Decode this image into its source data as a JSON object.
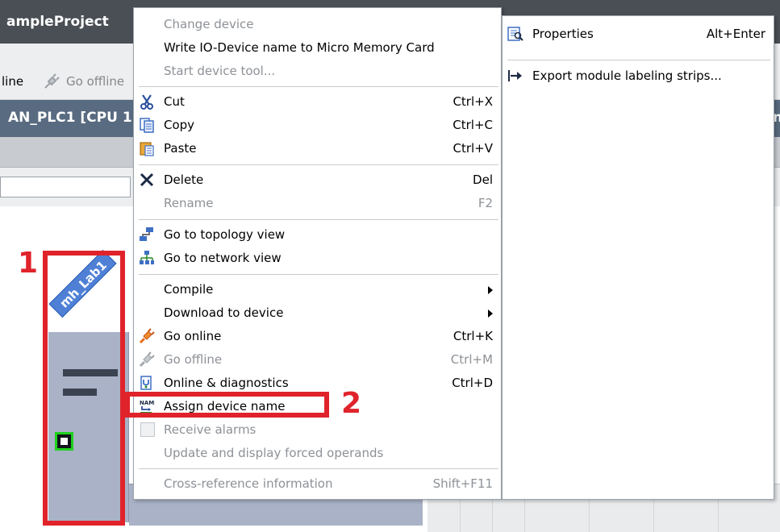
{
  "app": {
    "project_title": "ampleProject",
    "toolbar_items": [
      {
        "label": "line",
        "dim": false
      },
      {
        "label": "Go offline",
        "dim": true
      }
    ],
    "editor_title": "AN_PLC1 [CPU 1",
    "editor_title_suffix": "n"
  },
  "device": {
    "label": "mh_Lab1",
    "port_color": "#1ed21e"
  },
  "annotations": {
    "callout_1": "1",
    "callout_2": "2",
    "color": "#e0232b"
  },
  "context_menu": {
    "items": [
      {
        "label": "Change device",
        "shortcut": "",
        "disabled": true,
        "icon": ""
      },
      {
        "label": "Write IO-Device name to Micro Memory Card",
        "shortcut": "",
        "disabled": false,
        "icon": ""
      },
      {
        "label": "Start device tool...",
        "shortcut": "",
        "disabled": true,
        "icon": ""
      },
      {
        "label": "Cut",
        "shortcut": "Ctrl+X",
        "disabled": false,
        "icon": "scissors-icon"
      },
      {
        "label": "Copy",
        "shortcut": "Ctrl+C",
        "disabled": false,
        "icon": "copy-icon"
      },
      {
        "label": "Paste",
        "shortcut": "Ctrl+V",
        "disabled": false,
        "icon": "paste-icon"
      },
      {
        "label": "Delete",
        "shortcut": "Del",
        "disabled": false,
        "icon": "delete-icon"
      },
      {
        "label": "Rename",
        "shortcut": "F2",
        "disabled": true,
        "icon": ""
      },
      {
        "label": "Go to topology view",
        "shortcut": "",
        "disabled": false,
        "icon": "topology-icon"
      },
      {
        "label": "Go to network view",
        "shortcut": "",
        "disabled": false,
        "icon": "network-icon"
      },
      {
        "label": "Compile",
        "shortcut": "",
        "disabled": false,
        "icon": "",
        "submenu": true
      },
      {
        "label": "Download to device",
        "shortcut": "",
        "disabled": false,
        "icon": "",
        "submenu": true
      },
      {
        "label": "Go online",
        "shortcut": "Ctrl+K",
        "disabled": false,
        "icon": "go-online-icon"
      },
      {
        "label": "Go offline",
        "shortcut": "Ctrl+M",
        "disabled": true,
        "icon": "go-offline-icon"
      },
      {
        "label": "Online & diagnostics",
        "shortcut": "Ctrl+D",
        "disabled": false,
        "icon": "diagnostics-icon"
      },
      {
        "label": "Assign device name",
        "shortcut": "",
        "disabled": false,
        "icon": "assign-name-icon"
      },
      {
        "label": "Receive alarms",
        "shortcut": "",
        "disabled": true,
        "icon": "checkbox-icon"
      },
      {
        "label": "Update and display forced operands",
        "shortcut": "",
        "disabled": true,
        "icon": ""
      },
      {
        "label": "Cross-reference information",
        "shortcut": "Shift+F11",
        "disabled": true,
        "icon": ""
      }
    ]
  },
  "side_menu": {
    "items": [
      {
        "label": "Properties",
        "shortcut": "Alt+Enter",
        "icon": "properties-icon"
      },
      {
        "label": "Export module labeling strips...",
        "shortcut": "",
        "icon": "export-arrow-icon"
      }
    ]
  }
}
